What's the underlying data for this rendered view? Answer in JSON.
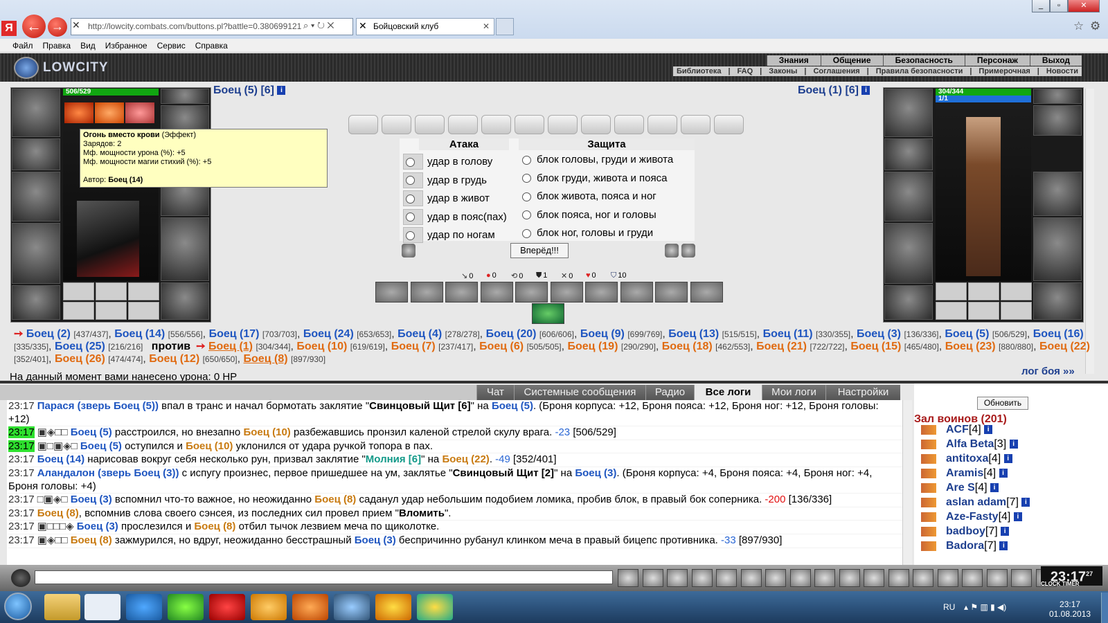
{
  "browser": {
    "url": "http://lowcity.combats.com/buttons.pl?battle=0.380699121",
    "tab_title": "Бойцовский клуб",
    "menu": [
      "Файл",
      "Правка",
      "Вид",
      "Избранное",
      "Сервис",
      "Справка"
    ]
  },
  "site": {
    "logo_text": "LOWCITY",
    "top_menu": [
      "Знания",
      "Общение",
      "Безопасность",
      "Персонаж",
      "Выход"
    ],
    "sub_menu": [
      "Библиотека",
      "|",
      "FAQ",
      "|",
      "Законы",
      "|",
      "Соглашения",
      "|",
      "Правила безопасности",
      "|",
      "Примерочная",
      "|",
      "Новости"
    ]
  },
  "left_fighter": {
    "name": "Боец (5) [6]",
    "hp": "506/529"
  },
  "right_fighter": {
    "name": "Боец (1) [6]",
    "hp": "304/344",
    "mana": "1/1"
  },
  "tooltip": {
    "title": "Огонь вместо крови",
    "kind": " (Эффект)",
    "lines": [
      "Зарядов: 2",
      "Мф. мощности урона (%): +5",
      "Мф. мощности магии стихий (%): +5"
    ],
    "author_label": "Автор: ",
    "author": "Боец (14)"
  },
  "combat": {
    "attack_header": "Атака",
    "defense_header": "Защита",
    "attacks": [
      "удар в голову",
      "удар в грудь",
      "удар в живот",
      "удар в пояс(пах)",
      "удар по ногам"
    ],
    "defenses": [
      "блок головы, груди и живота",
      "блок груди, живота и пояса",
      "блок живота, пояса и ног",
      "блок пояса, ног и головы",
      "блок ног, головы и груди"
    ],
    "forward": "Вперёд!!!",
    "stats": [
      "0",
      "0",
      "0",
      "1",
      "0",
      "0",
      "10"
    ]
  },
  "teams": {
    "vs": "против",
    "left": [
      {
        "n": "Боец (2)",
        "hp": "[437/437]"
      },
      {
        "n": "Боец (14)",
        "hp": "[556/556]"
      },
      {
        "n": "Боец (17)",
        "hp": "[703/703]"
      },
      {
        "n": "Боец (24)",
        "hp": "[653/653]"
      },
      {
        "n": "Боец (4)",
        "hp": "[278/278]"
      },
      {
        "n": "Боец (20)",
        "hp": "[606/606]"
      },
      {
        "n": "Боец (9)",
        "hp": "[699/769]"
      },
      {
        "n": "Боец (13)",
        "hp": "[515/515]"
      },
      {
        "n": "Боец (11)",
        "hp": "[330/355]"
      },
      {
        "n": "Боец (3)",
        "hp": "[136/336]"
      },
      {
        "n": "Боец (5)",
        "hp": "[506/529]"
      },
      {
        "n": "Боец (16)",
        "hp": "[335/335]"
      },
      {
        "n": "Боец (25)",
        "hp": "[216/216]"
      }
    ],
    "right": [
      {
        "n": "Боец (1)",
        "hp": "[304/344]"
      },
      {
        "n": "Боец (10)",
        "hp": "[619/619]"
      },
      {
        "n": "Боец (7)",
        "hp": "[237/417]"
      },
      {
        "n": "Боец (6)",
        "hp": "[505/505]"
      },
      {
        "n": "Боец (19)",
        "hp": "[290/290]"
      },
      {
        "n": "Боец (18)",
        "hp": "[462/553]"
      },
      {
        "n": "Боец (21)",
        "hp": "[722/722]"
      },
      {
        "n": "Боец (15)",
        "hp": "[465/480]"
      },
      {
        "n": "Боец (23)",
        "hp": "[880/880]"
      },
      {
        "n": "Боец (22)",
        "hp": "[352/401]"
      },
      {
        "n": "Боец (26)",
        "hp": "[474/474]"
      },
      {
        "n": "Боец (12)",
        "hp": "[650/650]"
      },
      {
        "n": "Боец (8)",
        "hp": "[897/930]"
      }
    ]
  },
  "damage_line": "На данный момент вами нанесено урона: 0 HP",
  "log_link": "лог боя »»",
  "chat_tabs": [
    "Чат",
    "Системные сообщения",
    "Радио",
    "Все логи",
    "Мои логи",
    "Настройки"
  ],
  "chat": [
    {
      "t": "23:17",
      "g": false,
      "segs": [
        [
          "b",
          "Парася (зверь Боец (5))"
        ],
        [
          "n",
          " впал в транс и начал бормотать заклятие \""
        ],
        [
          "k",
          "Свинцовый Щит [6]"
        ],
        [
          "n",
          "\" на "
        ],
        [
          "b",
          "Боец (5)"
        ],
        [
          "n",
          ". (Броня корпуса: +12, Броня пояса: +12, Броня ног: +12, Броня головы: +12)"
        ]
      ]
    },
    {
      "t": "23:17",
      "g": true,
      "segs": [
        [
          "x",
          "▣◈□□"
        ],
        [
          "b",
          " Боец (5)"
        ],
        [
          "n",
          " расстроился, но внезапно "
        ],
        [
          "r",
          "Боец (10)"
        ],
        [
          "n",
          " разбежавшись пронзил каленой стрелой скулу врага. "
        ],
        [
          "d",
          "-23"
        ],
        [
          "n",
          " [506/529]"
        ]
      ]
    },
    {
      "t": "23:17",
      "g": true,
      "segs": [
        [
          "x",
          "▣□▣◈□"
        ],
        [
          "b",
          " Боец (5)"
        ],
        [
          "n",
          " оступился и "
        ],
        [
          "r",
          "Боец (10)"
        ],
        [
          "n",
          " уклонился от удара ручкой топора в пах."
        ]
      ]
    },
    {
      "t": "23:17",
      "g": false,
      "segs": [
        [
          "b",
          "Боец (14)"
        ],
        [
          "n",
          " нарисовав вокруг себя несколько рун, призвал заклятие \""
        ],
        [
          "c",
          "Молния [6]"
        ],
        [
          "n",
          "\" на "
        ],
        [
          "r",
          "Боец (22)"
        ],
        [
          "n",
          ". "
        ],
        [
          "d",
          "-49"
        ],
        [
          "n",
          " [352/401]"
        ]
      ]
    },
    {
      "t": "23:17",
      "g": false,
      "segs": [
        [
          "b",
          "Аландалон (зверь Боец (3))"
        ],
        [
          "n",
          " с испугу произнес, первое пришедшее на ум, заклятье \""
        ],
        [
          "k",
          "Свинцовый Щит [2]"
        ],
        [
          "n",
          "\" на "
        ],
        [
          "b",
          "Боец (3)"
        ],
        [
          "n",
          ". (Броня корпуса: +4, Броня пояса: +4, Броня ног: +4, Броня головы: +4)"
        ]
      ]
    },
    {
      "t": "23:17",
      "g": false,
      "segs": [
        [
          "x",
          "□▣◈□"
        ],
        [
          "b",
          " Боец (3)"
        ],
        [
          "n",
          " вспомнил что-то важное, но неожиданно "
        ],
        [
          "r",
          "Боец (8)"
        ],
        [
          "n",
          " саданул удар небольшим подобием ломика, пробив блок, в правый бок соперника. "
        ],
        [
          "e",
          "-200"
        ],
        [
          "n",
          " [136/336]"
        ]
      ]
    },
    {
      "t": "23:17",
      "g": false,
      "segs": [
        [
          "r",
          "Боец (8)"
        ],
        [
          "n",
          ", вспомнив слова своего сэнсея, из последних сил провел прием \""
        ],
        [
          "k",
          "Вломить"
        ],
        [
          "n",
          "\"."
        ]
      ]
    },
    {
      "t": "23:17",
      "g": false,
      "segs": [
        [
          "x",
          "▣□□□◈"
        ],
        [
          "b",
          " Боец (3)"
        ],
        [
          "n",
          " прослезился и "
        ],
        [
          "r",
          "Боец (8)"
        ],
        [
          "n",
          " отбил тычок лезвием меча по щиколотке."
        ]
      ]
    },
    {
      "t": "23:17",
      "g": false,
      "segs": [
        [
          "x",
          "▣◈□□"
        ],
        [
          "r",
          " Боец (8)"
        ],
        [
          "n",
          " зажмурился, но вдруг, неожиданно бесстрашный "
        ],
        [
          "b",
          "Боец (3)"
        ],
        [
          "n",
          " беспричинно рубанул клинком меча в правый бицепс противника. "
        ],
        [
          "d",
          "-33"
        ],
        [
          "n",
          " [897/930]"
        ]
      ]
    }
  ],
  "side": {
    "refresh": "Обновить",
    "hall": "Зал воинов (201)",
    "warriors": [
      {
        "n": "ACF",
        "lvl": "[4]"
      },
      {
        "n": "Alfa Beta",
        "lvl": "[3]"
      },
      {
        "n": "antitoxa",
        "lvl": "[4]"
      },
      {
        "n": "Aramis",
        "lvl": "[4]"
      },
      {
        "n": "Are S",
        "lvl": "[4]"
      },
      {
        "n": "aslan adam",
        "lvl": "[7]"
      },
      {
        "n": "Aze-Fasty",
        "lvl": "[4]"
      },
      {
        "n": "badboy",
        "lvl": "[7]"
      },
      {
        "n": "Badora",
        "lvl": "[7]"
      }
    ]
  },
  "clock": {
    "time": "23:17",
    "sec": "27",
    "labels": "CLOCK TIMER"
  },
  "taskbar": {
    "lang": "RU",
    "time": "23:17",
    "date": "01.08.2013"
  },
  "colors": {
    "red_team": "#e06a10",
    "blue_team": "#1e55c0",
    "hp_green": "#11a711",
    "damage": "#e21010"
  }
}
